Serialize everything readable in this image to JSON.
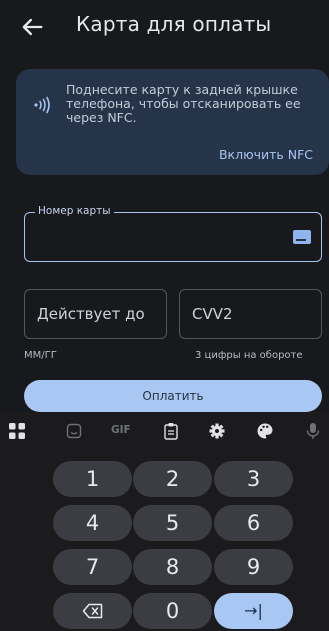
{
  "header": {
    "title": "Карта для оплаты",
    "back_icon": "arrow-left-icon"
  },
  "nfc": {
    "text": "Поднесите карту к задней крышке телефона, чтобы отсканировать ее через NFC.",
    "enable_label": "Включить NFC",
    "icon": "nfc-icon"
  },
  "card_number": {
    "label": "Номер карты",
    "value": "",
    "icon": "credit-card-icon"
  },
  "expiry": {
    "placeholder": "Действует до",
    "hint": "ММ/ГГ"
  },
  "cvv": {
    "placeholder": "CVV2",
    "hint": "3 цифры на обороте"
  },
  "pay_button": {
    "label": "Оплатить"
  },
  "keyboard": {
    "toolbar": [
      "apps-grid-icon",
      "sticker-icon",
      "GIF",
      "clipboard-icon",
      "settings-icon",
      "palette-icon",
      "microphone-icon"
    ],
    "rows": [
      [
        "1",
        "2",
        "3"
      ],
      [
        "4",
        "5",
        "6"
      ],
      [
        "7",
        "8",
        "9"
      ],
      [
        "backspace-icon",
        "0",
        "→|"
      ]
    ],
    "colors": {
      "accent": "#a8c7f3",
      "key": "#3b3d42"
    }
  }
}
